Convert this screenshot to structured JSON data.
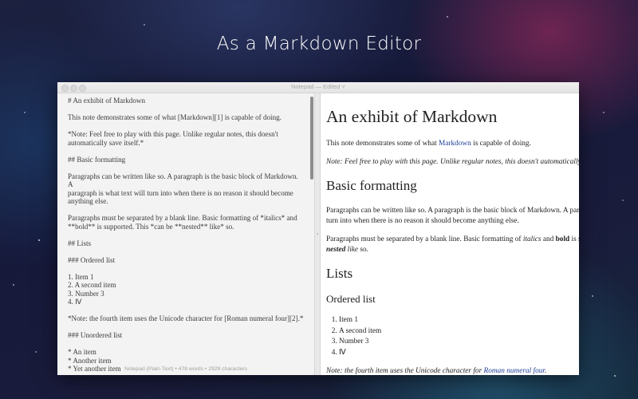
{
  "headline": "As a Markdown Editor",
  "window": {
    "title": "Notepad — Edited ˅"
  },
  "editor": {
    "lines": [
      "# An exhibit of Markdown",
      "",
      "This note demonstrates some of what [Markdown][1] is capable of doing.",
      "",
      "*Note: Feel free to play with this page. Unlike regular notes, this doesn't",
      "automatically save itself.*",
      "",
      "## Basic formatting",
      "",
      "Paragraphs can be written like so. A paragraph is the basic block of Markdown. A",
      "paragraph is what text will turn into when there is no reason it should become",
      "anything else.",
      "",
      "Paragraphs must be separated by a blank line. Basic formatting of *italics* and",
      "**bold** is supported. This *can be **nested** like* so.",
      "",
      "## Lists",
      "",
      "### Ordered list",
      "",
      "1. Item 1",
      "2. A second item",
      "3. Number 3",
      "4. Ⅳ",
      "",
      "*Note: the fourth item uses the Unicode character for [Roman numeral four][2].*",
      "",
      "### Unordered list",
      "",
      "* An item",
      "* Another item",
      "* Yet another item"
    ],
    "status": "Notepad (Plain Text) • 478 words • 2929 characters"
  },
  "preview": {
    "h1": "An exhibit of Markdown",
    "intro_before": "This note demonstrates some of what ",
    "intro_link": "Markdown",
    "intro_after": " is capable of doing.",
    "note": "Note: Feel free to play with this page. Unlike regular notes, this doesn't automatically",
    "h2_basic": "Basic formatting",
    "para1_line1": "Paragraphs can be written like so. A paragraph is the basic block of Markdown. A parag",
    "para1_line2": "turn into when there is no reason it should become anything else.",
    "para2_before": "Paragraphs must be separated by a blank line. Basic formatting of ",
    "para2_italic": "italics",
    "para2_and": " and ",
    "para2_bold": "bold",
    "para2_tail": " is su",
    "para2_line2_nested": "nested",
    "para2_line2_after": " like",
    "para2_line2_end": " so.",
    "h2_lists": "Lists",
    "h3_ordered": "Ordered list",
    "ordered_items": [
      "Item 1",
      "A second item",
      "Number 3",
      "Ⅳ"
    ],
    "note2_before": "Note: the fourth item uses the Unicode character for ",
    "note2_link": "Roman numeral four",
    "note2_after": "."
  }
}
